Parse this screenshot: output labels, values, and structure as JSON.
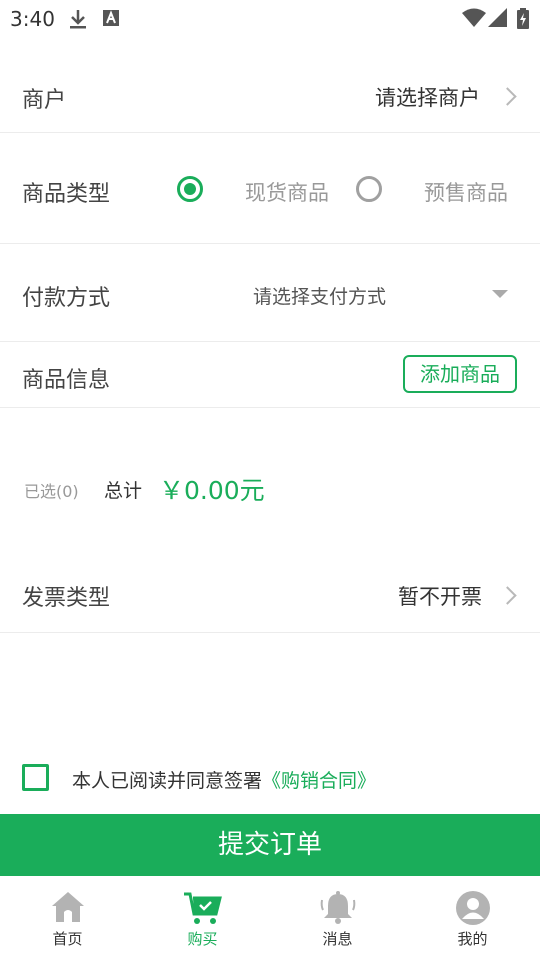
{
  "status_bar": {
    "time": "3:40",
    "icons": [
      "download-icon",
      "a-icon",
      "wifi-icon",
      "signal-icon",
      "battery-icon"
    ]
  },
  "form": {
    "merchant": {
      "label": "商户",
      "value": "请选择商户"
    },
    "product_type": {
      "label": "商品类型",
      "options": [
        "现货商品",
        "预售商品"
      ],
      "selected": 0
    },
    "payment": {
      "label": "付款方式",
      "placeholder": "请选择支付方式"
    },
    "product_info": {
      "label": "商品信息",
      "add_button": "添加商品"
    },
    "summary": {
      "selected": "已选(0)",
      "total_label": "总计",
      "total_value": "￥0.00元"
    },
    "invoice": {
      "label": "发票类型",
      "value": "暂不开票"
    }
  },
  "agreement": {
    "text": "本人已阅读并同意签署",
    "link": "《购销合同》",
    "checked": false
  },
  "submit_label": "提交订单",
  "tabbar": {
    "items": [
      {
        "label": "首页",
        "icon": "home-icon"
      },
      {
        "label": "购买",
        "icon": "cart-icon"
      },
      {
        "label": "消息",
        "icon": "bell-icon"
      },
      {
        "label": "我的",
        "icon": "user-icon"
      }
    ],
    "active": 1
  },
  "colors": {
    "accent": "#1aad5a",
    "text": "#444444",
    "muted": "#999999",
    "divider": "#ececec"
  }
}
